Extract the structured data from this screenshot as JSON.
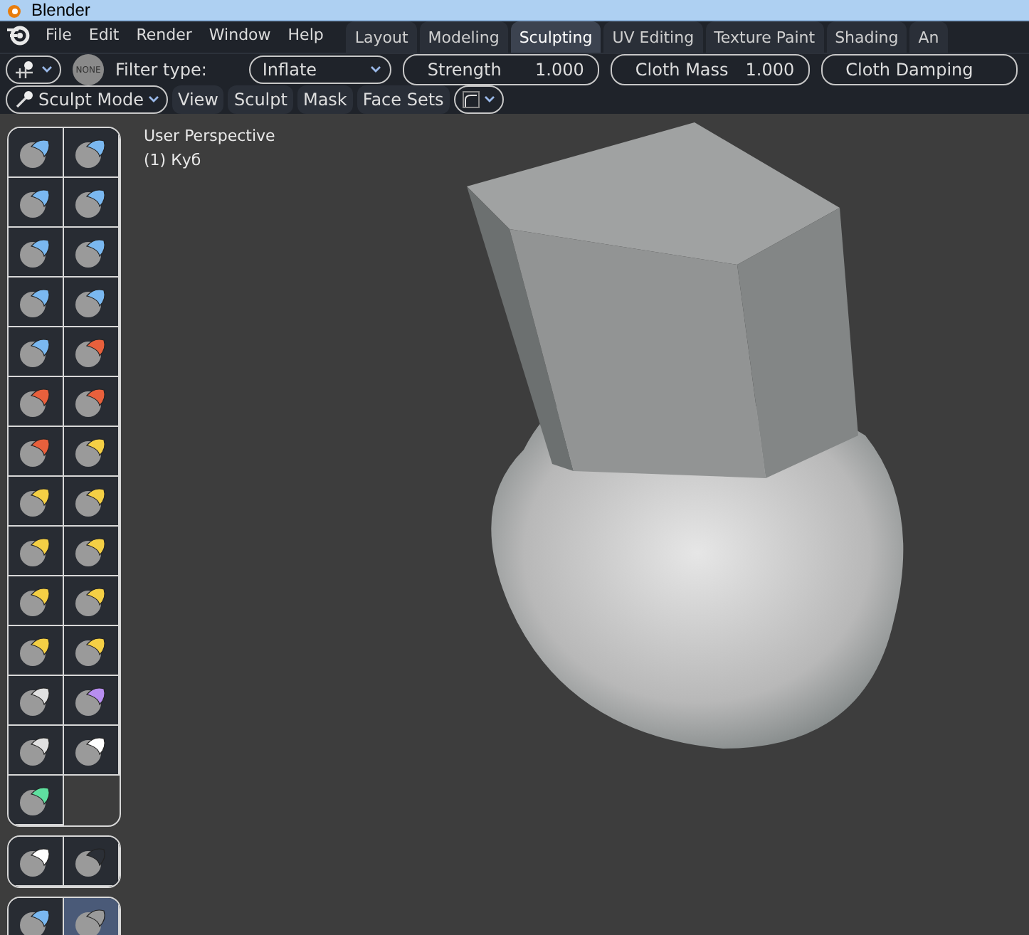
{
  "window": {
    "title": "Blender"
  },
  "menu": [
    "File",
    "Edit",
    "Render",
    "Window",
    "Help"
  ],
  "tabs": [
    {
      "label": "Layout",
      "selected": false
    },
    {
      "label": "Modeling",
      "selected": false
    },
    {
      "label": "Sculpting",
      "selected": true
    },
    {
      "label": "UV Editing",
      "selected": false
    },
    {
      "label": "Texture Paint",
      "selected": false
    },
    {
      "label": "Shading",
      "selected": false
    },
    {
      "label": "An",
      "selected": false
    }
  ],
  "tool_header": {
    "badge": "NONE",
    "filter_label": "Filter type:",
    "filter_value": "Inflate",
    "fields": [
      {
        "label": "Strength",
        "value": "1.000"
      },
      {
        "label": "Cloth Mass",
        "value": "1.000"
      },
      {
        "label": "Cloth Damping"
      }
    ]
  },
  "mode_bar": {
    "mode": "Sculpt Mode",
    "menus": [
      "View",
      "Sculpt",
      "Mask",
      "Face Sets"
    ]
  },
  "viewport": {
    "lines": [
      "User Perspective",
      "(1) Куб"
    ]
  },
  "toolbar": [
    {
      "tools": [
        {
          "color": "#7ab8f0",
          "selected": false
        },
        {
          "color": "#7ab8f0",
          "selected": false
        },
        {
          "color": "#7ab8f0",
          "selected": false
        },
        {
          "color": "#7ab8f0",
          "selected": false
        },
        {
          "color": "#7ab8f0",
          "selected": false
        },
        {
          "color": "#7ab8f0",
          "selected": false
        },
        {
          "color": "#7ab8f0",
          "selected": false
        },
        {
          "color": "#7ab8f0",
          "selected": false
        },
        {
          "color": "#7ab8f0",
          "selected": false
        },
        {
          "color": "#e8603c",
          "selected": false
        },
        {
          "color": "#e8603c",
          "selected": false
        },
        {
          "color": "#e8603c",
          "selected": false
        },
        {
          "color": "#e8603c",
          "selected": false
        },
        {
          "color": "#f4cf45",
          "selected": false
        },
        {
          "color": "#f4cf45",
          "selected": false
        },
        {
          "color": "#f4cf45",
          "selected": false
        },
        {
          "color": "#f4cf45",
          "selected": false
        },
        {
          "color": "#f4cf45",
          "selected": false
        },
        {
          "color": "#f4cf45",
          "selected": false
        },
        {
          "color": "#f4cf45",
          "selected": false
        },
        {
          "color": "#f4cf45",
          "selected": false
        },
        {
          "color": "#f4cf45",
          "selected": false
        },
        {
          "color": "#e0e0e0",
          "selected": false
        },
        {
          "color": "#b78ef0",
          "selected": false
        },
        {
          "color": "#e0e0e0",
          "selected": false
        },
        {
          "color": "#ffffff",
          "selected": false
        },
        {
          "color": "#5fe0a0",
          "selected": false
        }
      ]
    },
    {
      "tools": [
        {
          "color": "#ffffff",
          "selected": false
        },
        {
          "color": "#2b2f36",
          "selected": false
        }
      ]
    },
    {
      "tools": [
        {
          "color": "#7ab8f0",
          "selected": false
        },
        {
          "color": "#9a9a9a",
          "selected": true
        }
      ]
    }
  ]
}
